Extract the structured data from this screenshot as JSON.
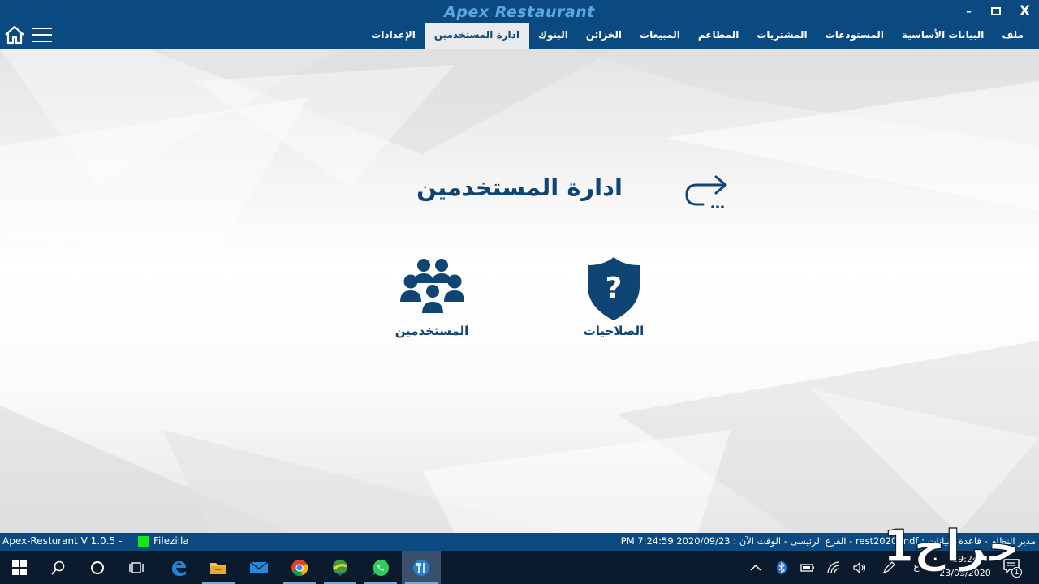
{
  "app": {
    "title": "Apex Restaurant",
    "window_controls": {
      "minimize": "-",
      "close": "X"
    }
  },
  "menu": {
    "items": [
      {
        "label": "ملف",
        "active": false
      },
      {
        "label": "البيانات الأساسية",
        "active": false
      },
      {
        "label": "المستودعات",
        "active": false
      },
      {
        "label": "المشتريات",
        "active": false
      },
      {
        "label": "المطاعم",
        "active": false
      },
      {
        "label": "المبيعات",
        "active": false
      },
      {
        "label": "الخزائن",
        "active": false
      },
      {
        "label": "البنوك",
        "active": false
      },
      {
        "label": "ادارة المستخدمين",
        "active": true
      },
      {
        "label": "الإعدادات",
        "active": false
      }
    ]
  },
  "page": {
    "title": "ادارة المستخدمين",
    "tiles": {
      "users": {
        "label": "المستخدمين",
        "icon": "users-group-icon"
      },
      "permissions": {
        "label": "الصلاحيات",
        "icon": "shield-question-icon"
      }
    }
  },
  "status": {
    "version": "Apex-Resturant V 1.0.5  -",
    "ftp": "Filezilla",
    "info": "مدير النظام  -  قاعدة البيانات : rest2020.mdf  -  الفرع الرئيسى  -  الوقت الآن : 2020/09/23 7:24:59 PM"
  },
  "taskbar": {
    "time": "19:24",
    "date": "23/09/2020",
    "lang": "ع",
    "notifications": "1",
    "apps": [
      "windows-start-icon",
      "search-icon",
      "cortana-icon",
      "task-view-icon",
      "edge-icon",
      "file-explorer-icon",
      "mail-icon",
      "chrome-icon",
      "idm-icon",
      "whatsapp-icon",
      "restaurant-app-icon"
    ]
  },
  "watermark": "حراج1",
  "colors": {
    "brand": "#0a4a80",
    "title_text": "#5aa6e0",
    "heading": "#0f4473",
    "taskbar": "#0b1a2c",
    "ftp_ok": "#19e619"
  }
}
